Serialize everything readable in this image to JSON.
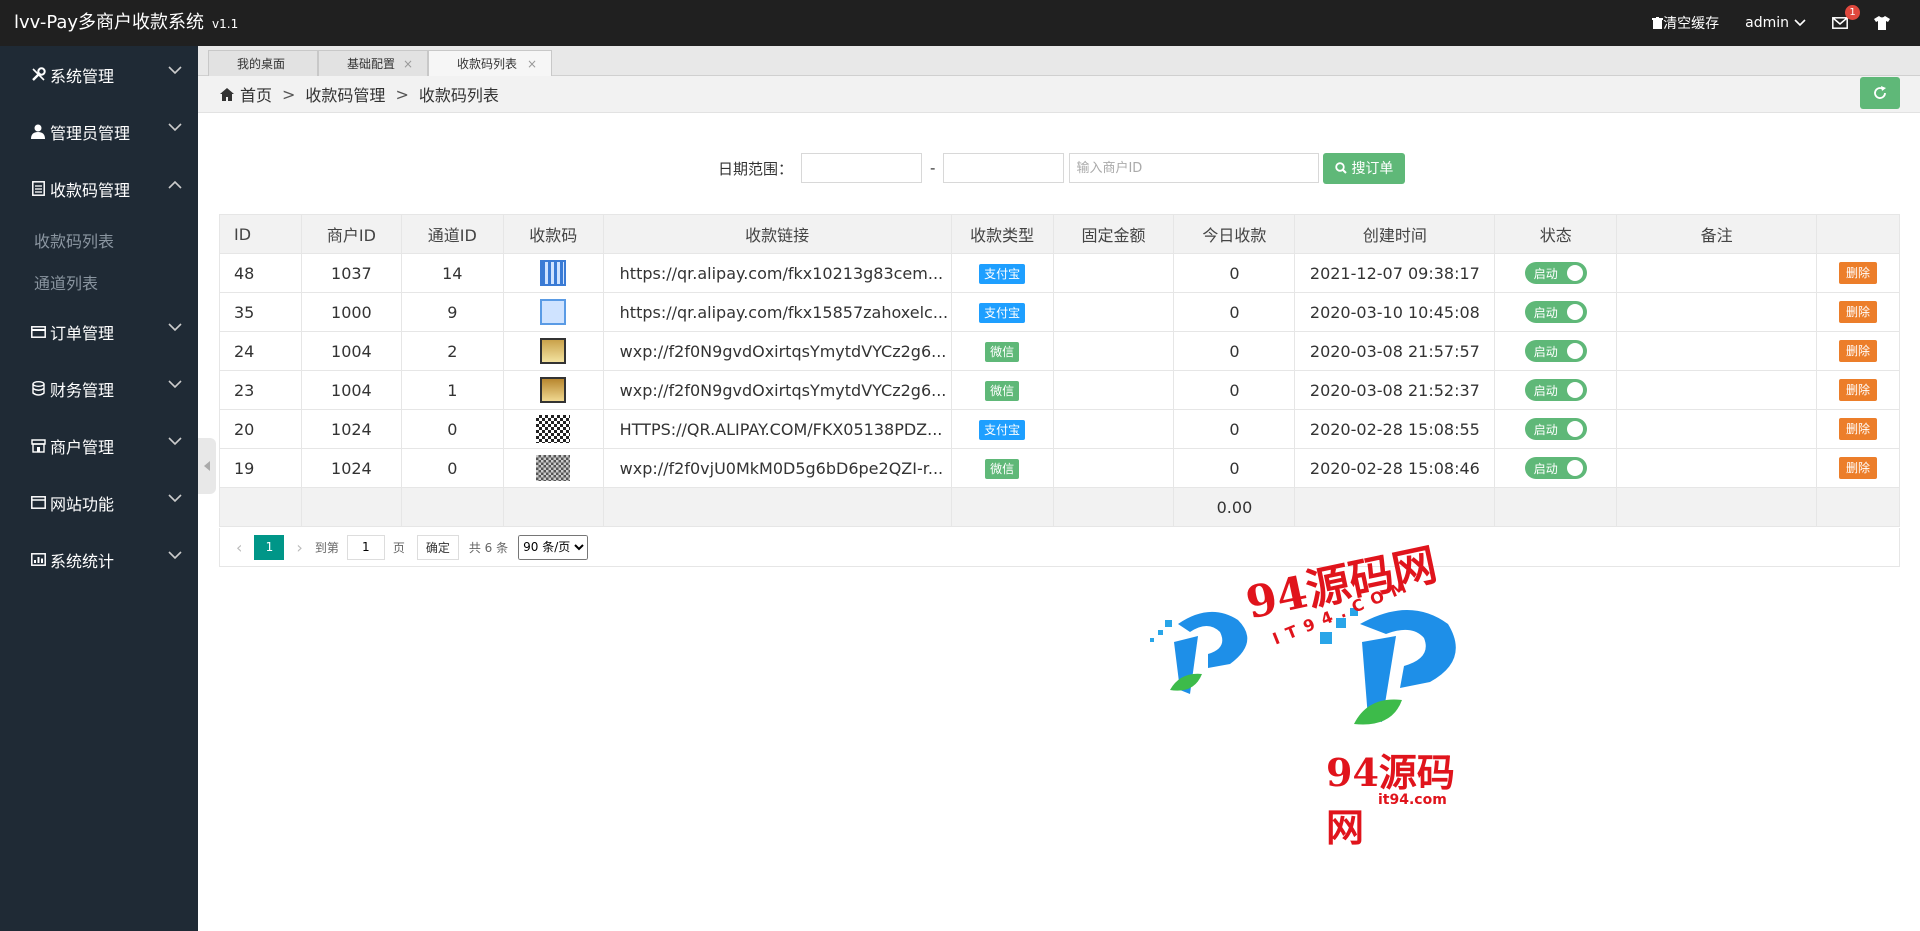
{
  "app": {
    "title": "lvv-Pay多商户收款系统",
    "version": "v1.1"
  },
  "header": {
    "clear_cache": "清空缓存",
    "user": "admin",
    "msg_count": "1"
  },
  "sidebar": {
    "items": [
      {
        "label": "系统管理",
        "icon": "wrench-icon"
      },
      {
        "label": "管理员管理",
        "icon": "user-icon"
      },
      {
        "label": "收款码管理",
        "icon": "document-icon",
        "expanded": true,
        "children": [
          {
            "label": "收款码列表"
          },
          {
            "label": "通道列表"
          }
        ]
      },
      {
        "label": "订单管理",
        "icon": "card-icon"
      },
      {
        "label": "财务管理",
        "icon": "database-icon"
      },
      {
        "label": "商户管理",
        "icon": "shop-icon"
      },
      {
        "label": "网站功能",
        "icon": "window-icon"
      },
      {
        "label": "系统统计",
        "icon": "chart-icon"
      }
    ]
  },
  "tabs": [
    {
      "label": "我的桌面"
    },
    {
      "label": "基础配置",
      "close": "×"
    },
    {
      "label": "收款码列表",
      "close": "×",
      "active": true
    }
  ],
  "breadcrumb": {
    "home": "首页",
    "level1": "收款码管理",
    "level2": "收款码列表",
    "sep": ">"
  },
  "search": {
    "date_label": "日期范围：",
    "dash": "-",
    "merchant_placeholder": "输入商户ID",
    "button": "搜订单"
  },
  "table": {
    "columns": [
      "ID",
      "商户ID",
      "通道ID",
      "收款码",
      "收款链接",
      "收款类型",
      "固定金额",
      "今日收款",
      "创建时间",
      "状态",
      "备注",
      ""
    ],
    "rows": [
      {
        "id": "48",
        "merchant": "1037",
        "channel": "14",
        "link": "https://qr.alipay.com/fkx10213g83cem...",
        "type": "支付宝",
        "fixed": "",
        "today": "0",
        "created": "2021-12-07 09:38:17",
        "status": "启动",
        "remark": "",
        "action": "删除"
      },
      {
        "id": "35",
        "merchant": "1000",
        "channel": "9",
        "link": "https://qr.alipay.com/fkx15857zahoxelc...",
        "type": "支付宝",
        "fixed": "",
        "today": "0",
        "created": "2020-03-10 10:45:08",
        "status": "启动",
        "remark": "",
        "action": "删除"
      },
      {
        "id": "24",
        "merchant": "1004",
        "channel": "2",
        "link": "wxp://f2f0N9gvdOxirtqsYmytdVYCz2g6...",
        "type": "微信",
        "fixed": "",
        "today": "0",
        "created": "2020-03-08 21:57:57",
        "status": "启动",
        "remark": "",
        "action": "删除"
      },
      {
        "id": "23",
        "merchant": "1004",
        "channel": "1",
        "link": "wxp://f2f0N9gvdOxirtqsYmytdVYCz2g6...",
        "type": "微信",
        "fixed": "",
        "today": "0",
        "created": "2020-03-08 21:52:37",
        "status": "启动",
        "remark": "",
        "action": "删除"
      },
      {
        "id": "20",
        "merchant": "1024",
        "channel": "0",
        "link": "HTTPS://QR.ALIPAY.COM/FKX05138PDZ...",
        "type": "支付宝",
        "fixed": "",
        "today": "0",
        "created": "2020-02-28 15:08:55",
        "status": "启动",
        "remark": "",
        "action": "删除"
      },
      {
        "id": "19",
        "merchant": "1024",
        "channel": "0",
        "link": "wxp://f2f0vjU0MkM0D5g6bD6pe2QZI-r...",
        "type": "微信",
        "fixed": "",
        "today": "0",
        "created": "2020-02-28 15:08:46",
        "status": "启动",
        "remark": "",
        "action": "删除"
      }
    ],
    "total_today": "0.00"
  },
  "pager": {
    "prev": "‹",
    "current": "1",
    "next": "›",
    "goto_label": "到第",
    "goto_value": "1",
    "page_unit": "页",
    "ok": "确定",
    "total": "共 6 条",
    "per_page": "90 条/页"
  },
  "watermark": {
    "title_top": "94源码网",
    "domain_top": "IT94.COM",
    "title_bottom": "94源码网",
    "domain_bottom": "it94.com"
  },
  "colors": {
    "sidebar_bg": "#1f2a35",
    "header_bg": "#202020",
    "green": "#5fb878",
    "blue": "#1e9fff",
    "orange": "#ec7e2a",
    "teal": "#009688"
  }
}
